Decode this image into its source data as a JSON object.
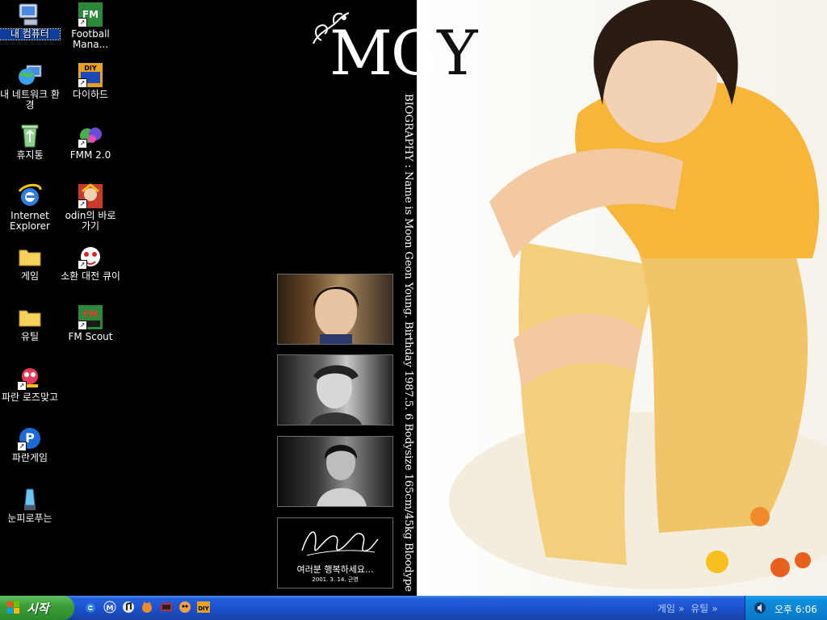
{
  "wallpaper": {
    "title_part1": "M",
    "title_part2": "G",
    "title_part3": "Y",
    "bio": "BIOGRAPHY : Name is Moon Geon Young. Birthday 1987.5. 6  Bodysize 165cm/45kg Bloodype B",
    "signature_message": "여러분 행복하세요...",
    "signature_date": "2001. 3. 14. 근영"
  },
  "desktop_icons": {
    "my_computer": "내 컴퓨터",
    "football_manager": "Football Mana...",
    "network": "내 네트워크 환경",
    "diy_hard": "다이하드",
    "recycle_bin": "휴지통",
    "fmm": "FMM 2.0",
    "internet_explorer": "Internet Explorer",
    "odin": "odin의 바로 가기",
    "games_folder": "게임",
    "summon": "소환 대전 큐이",
    "utils_folder": "유틸",
    "fm_scout": "FM Scout",
    "paran_rose": "파란 로즈맞고",
    "paran_game": "파란게임",
    "snow_lamp": "눈피로푸는"
  },
  "taskbar": {
    "start_label": "시작",
    "toolbar_games": "게임",
    "toolbar_utils": "유틸",
    "chevron": "»",
    "clock": "오후 6:06"
  },
  "colors": {
    "taskbar_blue": "#245edb",
    "start_green": "#3a9e3a",
    "tray_blue": "#0c77c8"
  }
}
